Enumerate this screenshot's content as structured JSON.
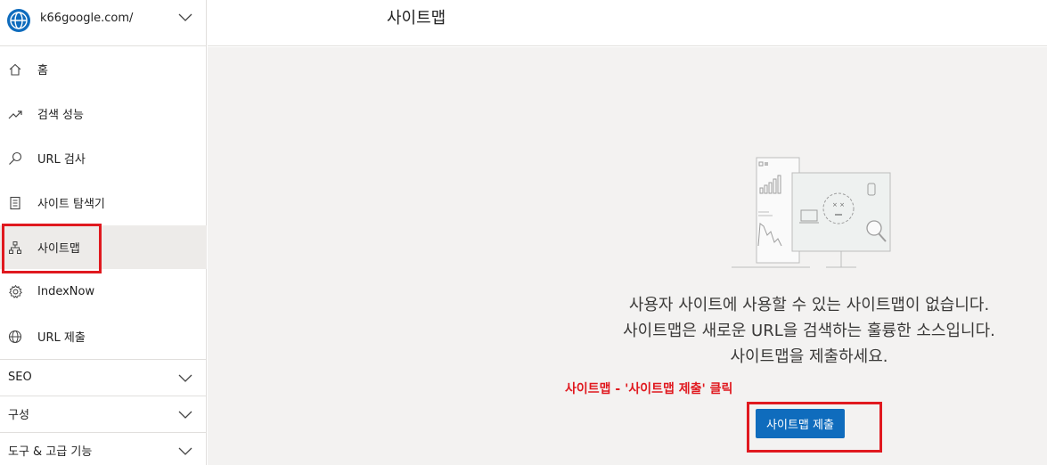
{
  "site": {
    "name": "k66google.com/"
  },
  "nav": {
    "items": [
      {
        "label": "홈",
        "icon": "home-icon"
      },
      {
        "label": "검색 성능",
        "icon": "trend-icon"
      },
      {
        "label": "URL 검사",
        "icon": "search-icon"
      },
      {
        "label": "사이트 탐색기",
        "icon": "document-icon"
      },
      {
        "label": "사이트맵",
        "icon": "sitemap-icon",
        "active": true
      },
      {
        "label": "IndexNow",
        "icon": "gear-icon"
      },
      {
        "label": "URL 제출",
        "icon": "globe-icon"
      }
    ],
    "sections": [
      {
        "label": "SEO"
      },
      {
        "label": "구성"
      },
      {
        "label": "도구 & 고급 기능"
      }
    ]
  },
  "header": {
    "title": "사이트맵"
  },
  "empty_state": {
    "line1": "사용자 사이트에 사용할 수 있는 사이트맵이 없습니다.",
    "line2": "사이트맵은 새로운 URL을 검색하는 훌륭한 소스입니다.",
    "line3": "사이트맵을 제출하세요."
  },
  "annotation": "사이트맵 - '사이트맵 제출' 클릭",
  "submit_button": "사이트맵 제출",
  "colors": {
    "accent": "#0f6cbd",
    "highlight": "#e0191f",
    "content_bg": "#f3f2f1"
  }
}
